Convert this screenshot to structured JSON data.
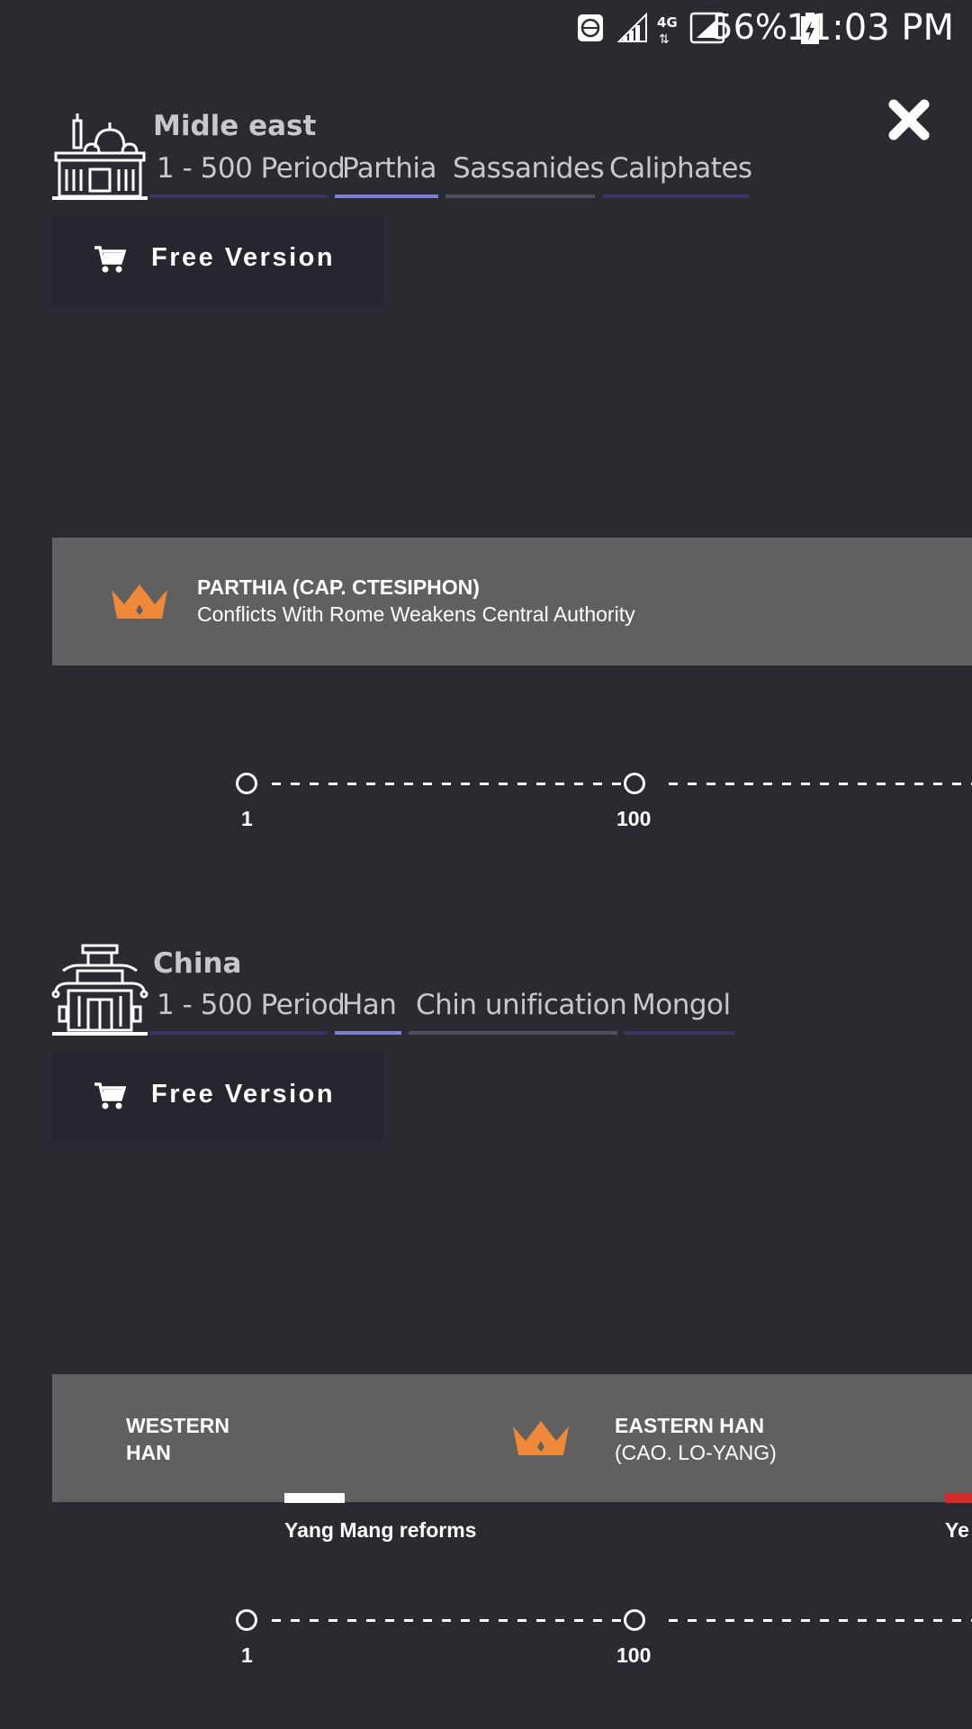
{
  "status_bar": {
    "battery": "56%",
    "time": "11:03 PM",
    "network": "4G"
  },
  "sections": [
    {
      "region": "Midle east",
      "tabs": [
        {
          "label": "1 - 500 Period",
          "color": "#3a3463"
        },
        {
          "label": "Parthia",
          "color": "#7b7fd6"
        },
        {
          "label": "Sassanides",
          "color": "#4d4f5e"
        },
        {
          "label": "Caliphates",
          "color": "#3a3466"
        }
      ],
      "free_label": "Free Version",
      "band": {
        "title": "PARTHIA (CAP. CTESIPHON)",
        "subtitle": "Conflicts With Rome Weakens Central Authority"
      },
      "timeline": [
        "1",
        "100"
      ]
    },
    {
      "region": "China",
      "tabs": [
        {
          "label": "1 - 500 Period",
          "color": "#3a3463"
        },
        {
          "label": "Han",
          "color": "#7b7fd6"
        },
        {
          "label": "Chin unification",
          "color": "#4d4f5e"
        },
        {
          "label": "Mongol",
          "color": "#3a3466"
        }
      ],
      "free_label": "Free Version",
      "band": {
        "left_title_1": "WESTERN",
        "left_title_2": "HAN",
        "title": "EASTERN HAN",
        "subtitle": "(CAO. LO-YANG)"
      },
      "events": [
        {
          "label": "Yang Mang reforms",
          "color": "#ffffff"
        },
        {
          "label": "Ye",
          "color": "#d42a2a"
        }
      ],
      "timeline": [
        "1",
        "100"
      ]
    }
  ],
  "accent_colors": {
    "crown": "#f0883a",
    "band": "#616060",
    "background": "#2a2b31"
  }
}
